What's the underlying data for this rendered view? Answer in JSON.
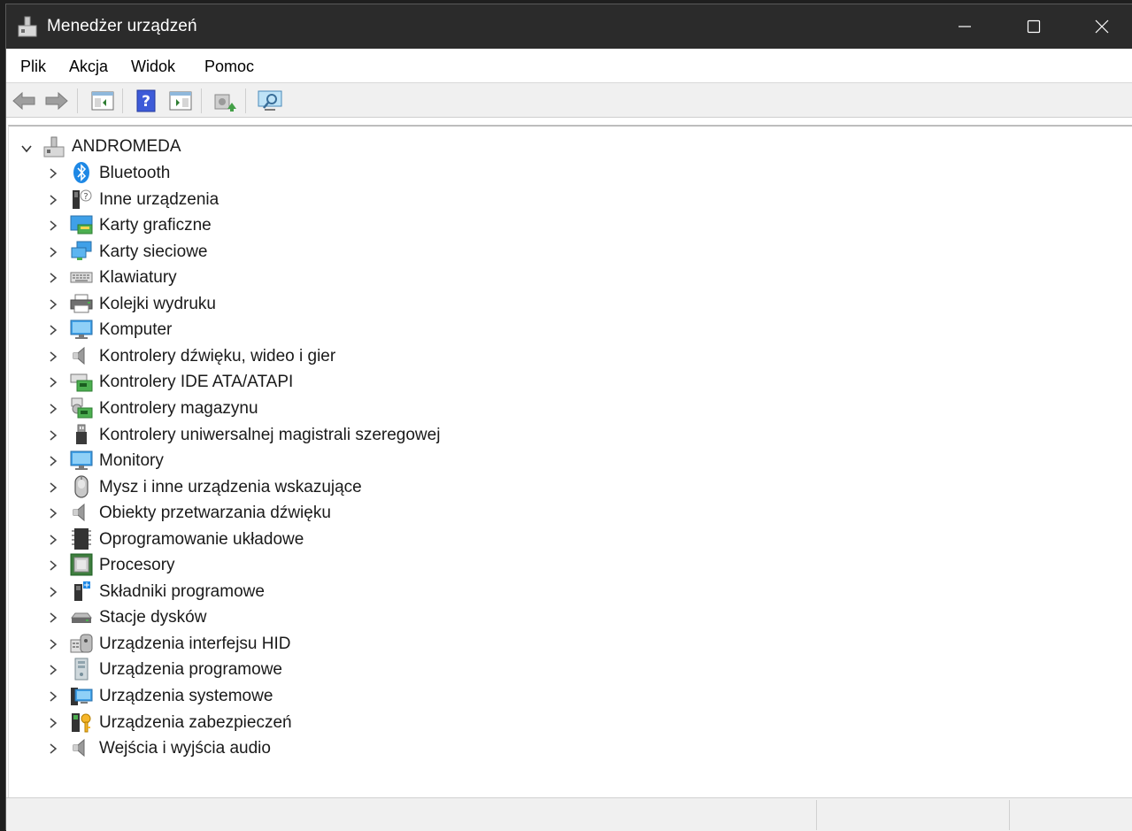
{
  "window": {
    "title": "Menedżer urządzeń"
  },
  "menu": {
    "items": [
      "Plik",
      "Akcja",
      "Widok",
      "Pomoc"
    ]
  },
  "toolbar": {
    "buttons": [
      "back-icon",
      "forward-icon",
      "show-hide-console-tree-icon",
      "help-icon",
      "action-pane-icon",
      "update-driver-icon",
      "scan-hardware-icon"
    ]
  },
  "tree": {
    "root": "ANDROMEDA",
    "items": [
      {
        "label": "Bluetooth",
        "icon": "bluetooth-icon"
      },
      {
        "label": "Inne urządzenia",
        "icon": "unknown-device-icon"
      },
      {
        "label": "Karty graficzne",
        "icon": "display-adapter-icon"
      },
      {
        "label": "Karty sieciowe",
        "icon": "network-adapter-icon"
      },
      {
        "label": "Klawiatury",
        "icon": "keyboard-icon"
      },
      {
        "label": "Kolejki wydruku",
        "icon": "printer-icon"
      },
      {
        "label": "Komputer",
        "icon": "computer-icon"
      },
      {
        "label": "Kontrolery dźwięku, wideo i gier",
        "icon": "speaker-icon"
      },
      {
        "label": "Kontrolery IDE ATA/ATAPI",
        "icon": "ide-controller-icon"
      },
      {
        "label": "Kontrolery magazynu",
        "icon": "storage-controller-icon"
      },
      {
        "label": "Kontrolery uniwersalnej magistrali szeregowej",
        "icon": "usb-icon"
      },
      {
        "label": "Monitory",
        "icon": "monitor-icon"
      },
      {
        "label": "Mysz i inne urządzenia wskazujące",
        "icon": "mouse-icon"
      },
      {
        "label": "Obiekty przetwarzania dźwięku",
        "icon": "speaker-icon"
      },
      {
        "label": "Oprogramowanie układowe",
        "icon": "firmware-chip-icon"
      },
      {
        "label": "Procesory",
        "icon": "processor-icon"
      },
      {
        "label": "Składniki programowe",
        "icon": "software-component-icon"
      },
      {
        "label": "Stacje dysków",
        "icon": "disk-drive-icon"
      },
      {
        "label": "Urządzenia interfejsu HID",
        "icon": "hid-icon"
      },
      {
        "label": "Urządzenia programowe",
        "icon": "software-device-icon"
      },
      {
        "label": "Urządzenia systemowe",
        "icon": "system-device-icon"
      },
      {
        "label": "Urządzenia zabezpieczeń",
        "icon": "security-device-icon"
      },
      {
        "label": "Wejścia i wyjścia audio",
        "icon": "speaker-icon"
      }
    ]
  },
  "colors": {
    "titlebar": "#2b2b2b",
    "toolbar": "#f0f0f0",
    "accent": "#1e88e5"
  }
}
